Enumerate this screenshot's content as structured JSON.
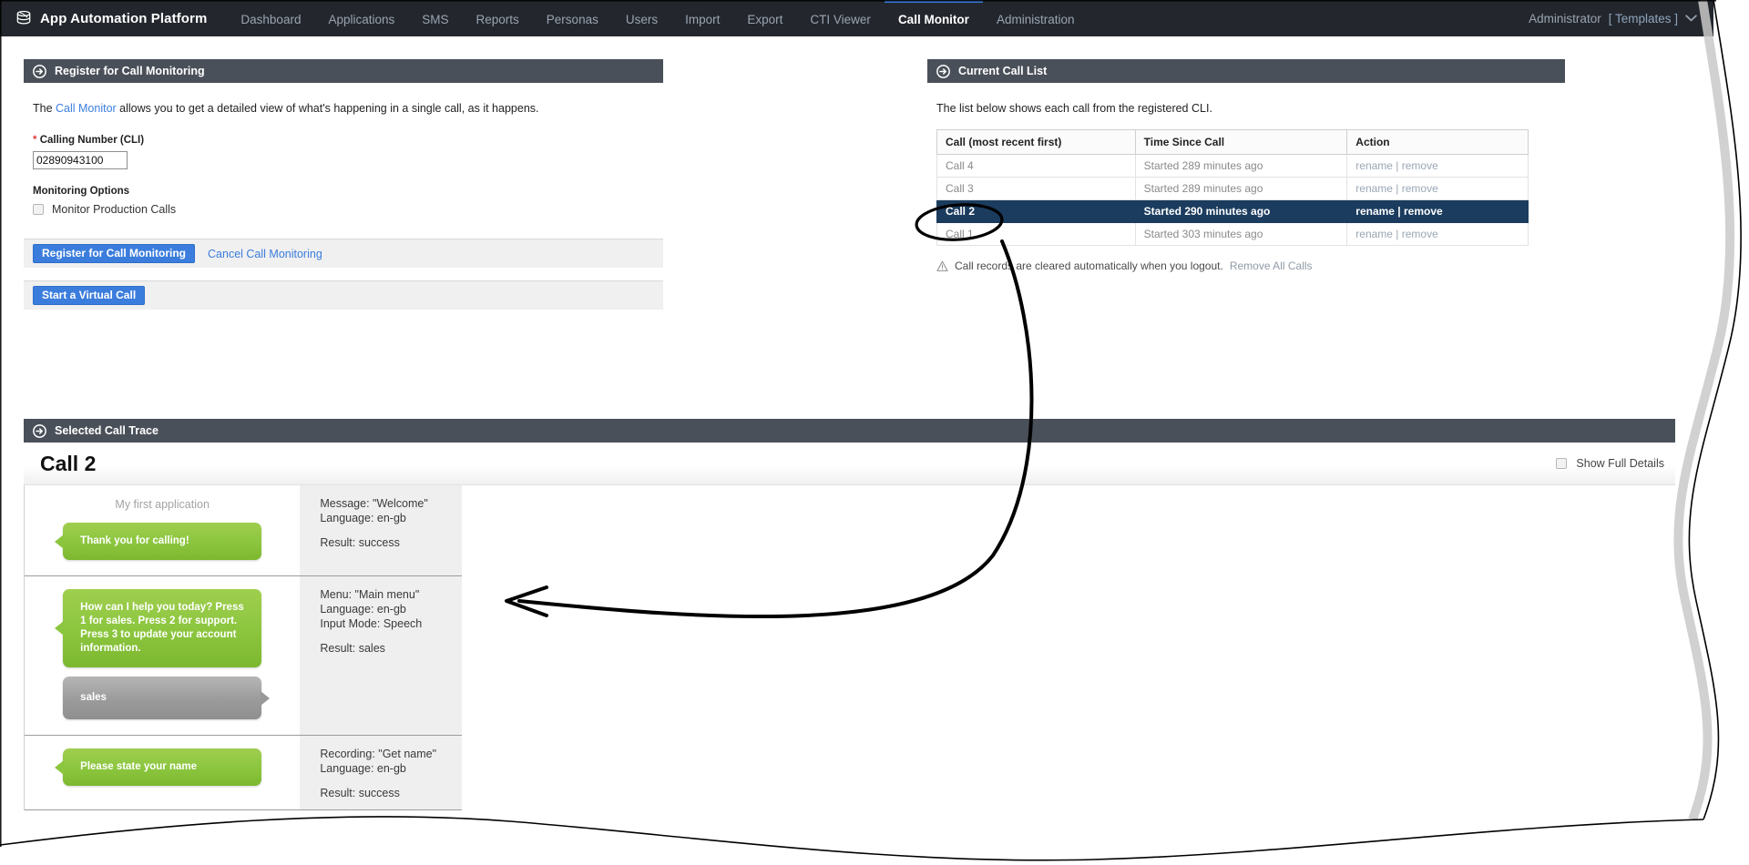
{
  "navbar": {
    "brand": "App Automation Platform",
    "brand_icon": "database-stack-icon",
    "items": [
      {
        "label": "Dashboard",
        "active": false
      },
      {
        "label": "Applications",
        "active": false
      },
      {
        "label": "SMS",
        "active": false
      },
      {
        "label": "Reports",
        "active": false
      },
      {
        "label": "Personas",
        "active": false
      },
      {
        "label": "Users",
        "active": false
      },
      {
        "label": "Import",
        "active": false
      },
      {
        "label": "Export",
        "active": false
      },
      {
        "label": "CTI Viewer",
        "active": false
      },
      {
        "label": "Call Monitor",
        "active": true
      },
      {
        "label": "Administration",
        "active": false
      }
    ],
    "user": "Administrator",
    "user_context": "[ Templates ]",
    "caret_icon": "chevron-down-icon",
    "active_accent": "#3b7ddd",
    "background": "#23272d"
  },
  "register_panel": {
    "title": "Register for Call Monitoring",
    "icon": "circle-arrow-right-icon",
    "intro_prefix": "The ",
    "intro_link": "Call Monitor",
    "intro_suffix": " allows you to get a detailed view of what's happening in a single call, as it happens.",
    "cli_label": "Calling Number (CLI)",
    "cli_required_marker": "*",
    "cli_value": "02890943100",
    "cli_placeholder": "",
    "options_title": "Monitoring Options",
    "monitor_production_label": "Monitor Production Calls",
    "monitor_production_checked": false,
    "register_button": "Register for Call Monitoring",
    "cancel_link": "Cancel Call Monitoring",
    "virtual_call_button": "Start a Virtual Call"
  },
  "call_list_panel": {
    "title": "Current Call List",
    "icon": "circle-arrow-right-icon",
    "intro": "The list below shows each call from the registered CLI.",
    "columns": [
      "Call (most recent first)",
      "Time Since Call",
      "Action"
    ],
    "rows": [
      {
        "call": "Call 4",
        "time": "Started 289 minutes ago",
        "action": "rename | remove",
        "selected": false
      },
      {
        "call": "Call 3",
        "time": "Started 289 minutes ago",
        "action": "rename | remove",
        "selected": false
      },
      {
        "call": "Call 2",
        "time": "Started 290 minutes ago",
        "action": "rename | remove",
        "selected": true
      },
      {
        "call": "Call 1",
        "time": "Started 303 minutes ago",
        "action": "rename | remove",
        "selected": false
      }
    ],
    "note_icon": "warning-triangle-icon",
    "note_text": "Call records are cleared automatically when you logout.",
    "note_link": "Remove All Calls",
    "selected_row_color": "#1b3c5e"
  },
  "trace_panel": {
    "title": "Selected Call Trace",
    "icon": "circle-arrow-right-icon",
    "call_title": "Call 2",
    "show_full_details_label": "Show Full Details",
    "show_full_details_checked": false,
    "app_name": "My first application",
    "steps": [
      {
        "prompt": "Thank you for calling!",
        "reply": null,
        "detail_lines": [
          "Message: \"Welcome\"",
          "Language: en-gb"
        ],
        "result": "Result: success"
      },
      {
        "prompt": "How can I help you today? Press 1 for sales. Press 2 for support. Press 3 to update your account information.",
        "reply": "sales",
        "detail_lines": [
          "Menu: \"Main menu\"",
          "Language: en-gb",
          "Input Mode: Speech"
        ],
        "result": "Result: sales"
      },
      {
        "prompt": "Please state your name",
        "reply": null,
        "detail_lines": [
          "Recording: \"Get name\"",
          "Language: en-gb"
        ],
        "result": "Result: success"
      }
    ],
    "prompt_bubble_color": "#8cc63f",
    "reply_bubble_color": "#9b9b9b"
  },
  "annotation": {
    "type": "hand-drawn-callout",
    "ellipse_target": "Call 2",
    "arrow_points_to": "Selected Call Trace",
    "ink_color": "#000000"
  }
}
